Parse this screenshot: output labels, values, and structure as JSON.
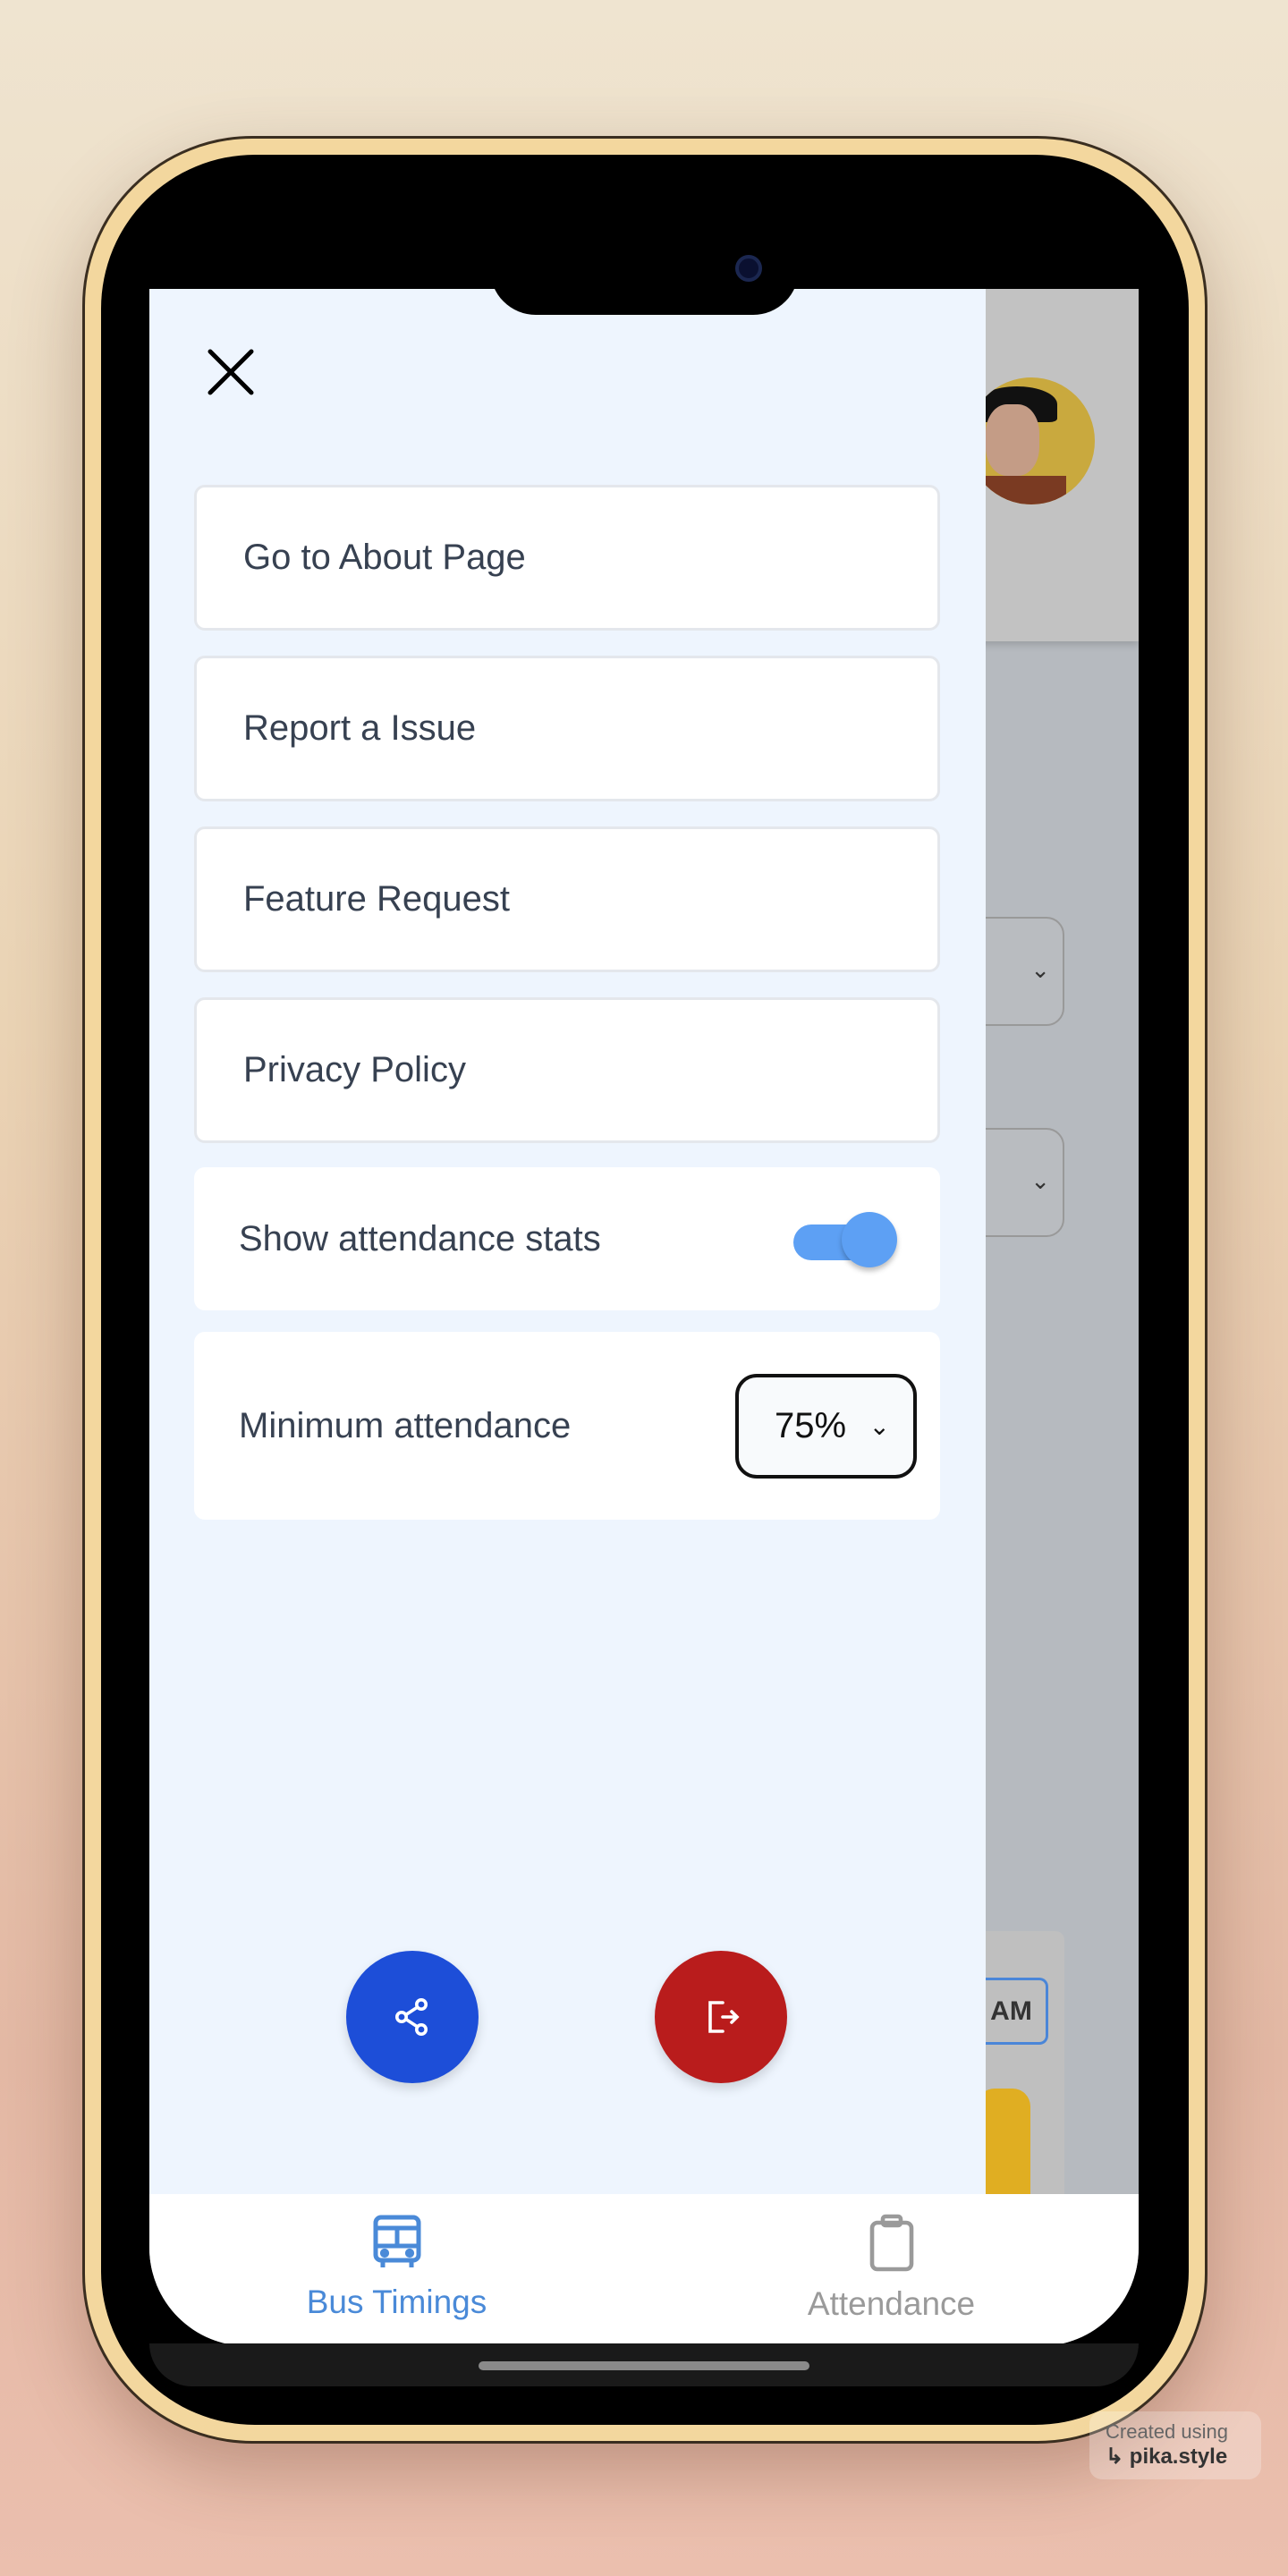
{
  "drawer": {
    "menu_items": [
      {
        "label": "Go to About Page"
      },
      {
        "label": "Report a Issue"
      },
      {
        "label": "Feature Request"
      },
      {
        "label": "Privacy Policy"
      }
    ],
    "show_stats": {
      "label": "Show attendance stats",
      "enabled": true
    },
    "min_attendance": {
      "label": "Minimum attendance",
      "value": "75%"
    },
    "actions": {
      "share_icon": "share-icon",
      "logout_icon": "logout-icon"
    }
  },
  "background": {
    "time_badge": "AM"
  },
  "bottom_nav": {
    "items": [
      {
        "label": "Bus Timings",
        "icon": "bus-icon",
        "active": true
      },
      {
        "label": "Attendance",
        "icon": "clipboard-icon",
        "active": false
      }
    ]
  },
  "watermark": {
    "line1": "Created using",
    "line2": "pika.style"
  },
  "colors": {
    "accent": "#5da0f4",
    "share": "#1d4ed8",
    "logout": "#b91c1c",
    "nav_active": "#4a8ad8",
    "nav_inactive": "#9a9a9a"
  }
}
